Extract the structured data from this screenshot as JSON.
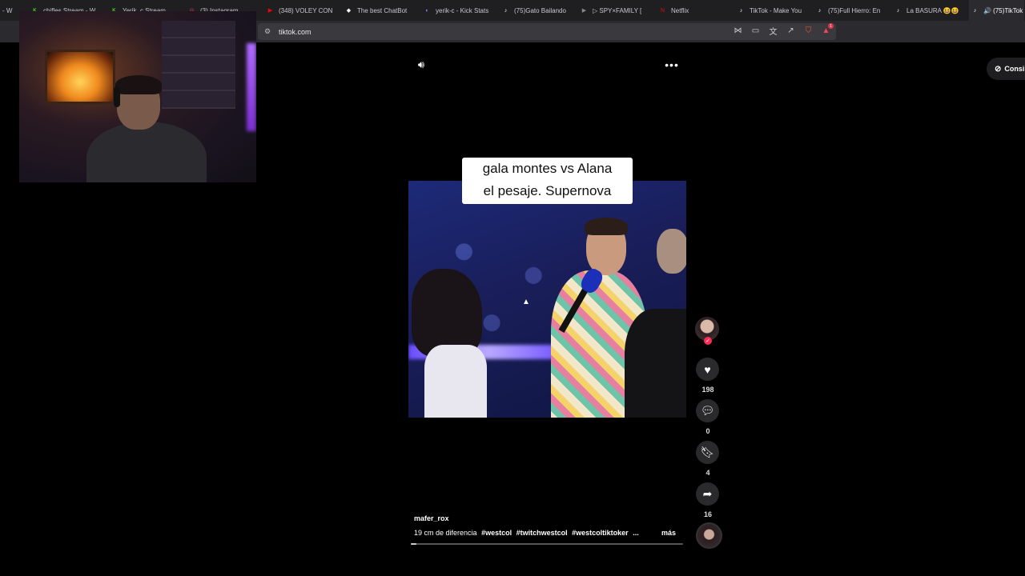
{
  "browser": {
    "tabs": [
      {
        "label": "- W",
        "icon": "",
        "color": "#555"
      },
      {
        "label": "chifles Stream - W",
        "icon": "K",
        "color": "#53fc18"
      },
      {
        "label": "Yerik_c Stream",
        "icon": "K",
        "color": "#53fc18"
      },
      {
        "label": "(3) Instagram",
        "icon": "◎",
        "color": "#e1306c"
      },
      {
        "label": "(348) VOLEY CON",
        "icon": "▶",
        "color": "#ff0000"
      },
      {
        "label": "The best ChatBot",
        "icon": "◆",
        "color": "#ffffff"
      },
      {
        "label": "yerik-c - Kick Stats",
        "icon": "◐",
        "color": "#9a7cff"
      },
      {
        "label": "(75)Gato Bailando",
        "icon": "♪",
        "color": "#ffffff"
      },
      {
        "label": "▷ SPY×FAMILY [",
        "icon": "▶",
        "color": "#888"
      },
      {
        "label": "Netflix",
        "icon": "N",
        "color": "#e50914"
      },
      {
        "label": "TikTok - Make You",
        "icon": "♪",
        "color": "#ffffff"
      },
      {
        "label": "(75)Full Hierro: En",
        "icon": "♪",
        "color": "#ffffff"
      },
      {
        "label": "La BASURA 😆😆",
        "icon": "♪",
        "color": "#ffffff"
      },
      {
        "label": "🔊 (75)TikTok",
        "icon": "♪",
        "color": "#ffffff"
      }
    ],
    "url": "tiktok.com",
    "rewards_badge": "1"
  },
  "post": {
    "caption_line1": "gala montes vs Alana",
    "caption_line2": "el pesaje. Supernova",
    "username": "mafer_rox",
    "description": "19 cm de diferencia",
    "hashtags": [
      "#westcol",
      "#twitchwestcol",
      "#westcoltiktoker",
      "..."
    ],
    "more_label": "más",
    "progress": 0.02
  },
  "actions": {
    "likes": "198",
    "comments": "0",
    "saves": "4",
    "shares": "16"
  },
  "consent_label": "Consi",
  "colors": {
    "accent": "#fe2c55",
    "kick": "#53fc18"
  }
}
